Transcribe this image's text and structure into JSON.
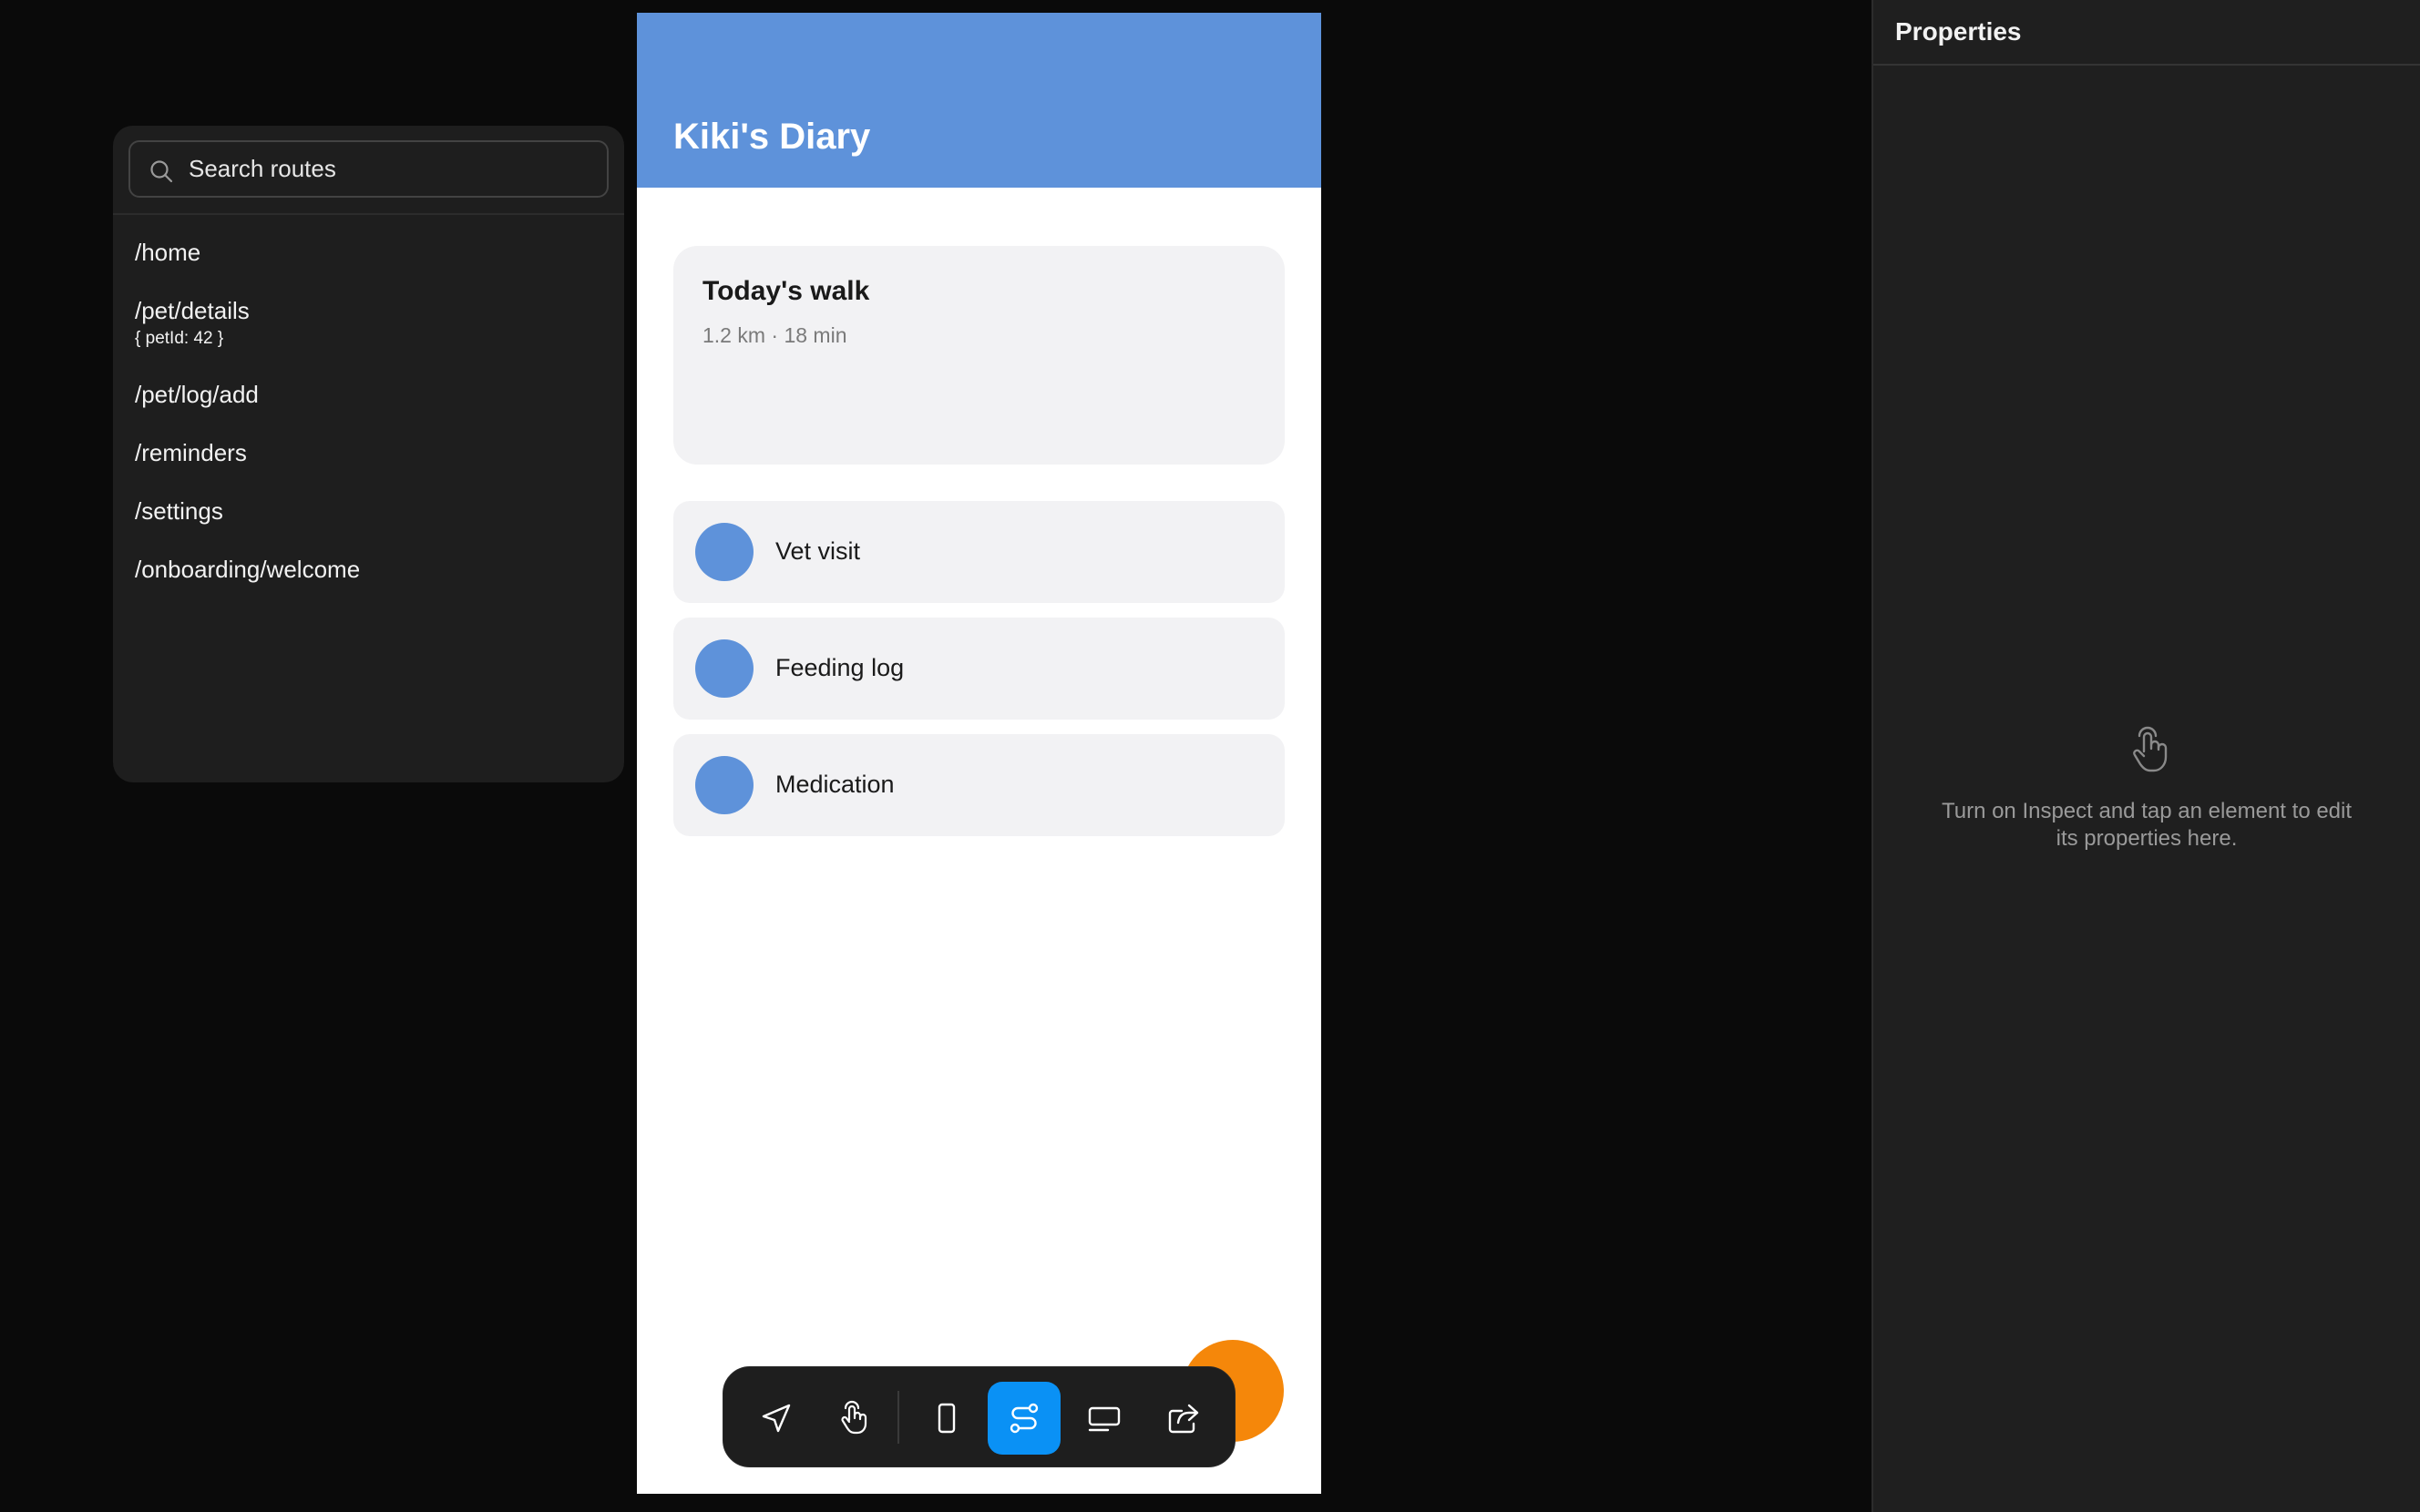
{
  "routes_panel": {
    "search": {
      "placeholder": "Search routes",
      "value": "",
      "icon": "search-icon"
    },
    "routes": [
      {
        "path": "/home"
      },
      {
        "path": "/pet/details",
        "params": "{ petId: 42 }"
      },
      {
        "path": "/pet/log/add"
      },
      {
        "path": "/reminders"
      },
      {
        "path": "/settings"
      },
      {
        "path": "/onboarding/welcome"
      }
    ]
  },
  "phone": {
    "header": {
      "title": "Kiki's Diary",
      "color": "#5e92da"
    },
    "walk_card": {
      "title": "Today's walk",
      "stats": "1.2 km · 18 min"
    },
    "list": [
      {
        "label": "Vet visit"
      },
      {
        "label": "Feeding log"
      },
      {
        "label": "Medication"
      }
    ],
    "fab_color": "#f5870a"
  },
  "toolbar": {
    "tools": [
      {
        "icon": "navigate-icon",
        "active": false
      },
      {
        "icon": "tap-icon",
        "active": false
      },
      {
        "icon": "device-icon",
        "active": false
      },
      {
        "icon": "routes-icon",
        "active": true
      },
      {
        "icon": "overlay-icon",
        "active": false
      },
      {
        "icon": "share-icon",
        "active": false
      }
    ],
    "active_color": "#0a91f5"
  },
  "properties_panel": {
    "title": "Properties",
    "empty_icon": "tap-icon",
    "empty_message": "Turn on Inspect and tap an element to edit its properties here."
  }
}
